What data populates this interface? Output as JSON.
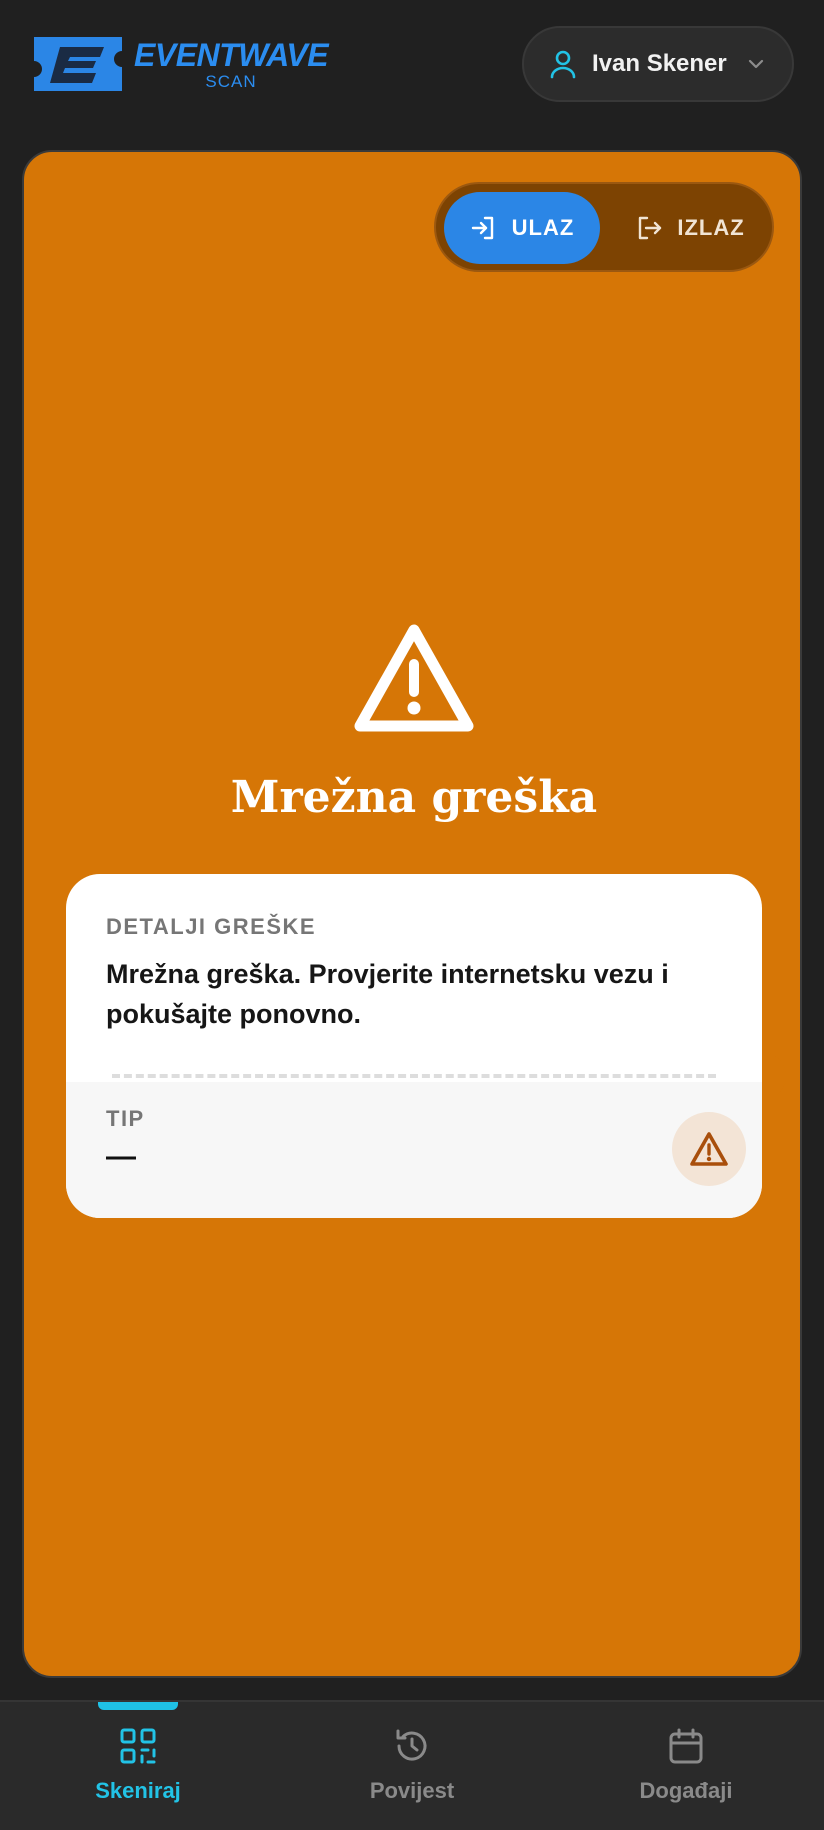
{
  "brand": {
    "name": "EVENTWAVE",
    "subtitle": "SCAN",
    "color": "#2b8df0"
  },
  "user": {
    "name": "Ivan Skener",
    "icon": "user-icon",
    "accent": "#22c3e6"
  },
  "mode_toggle": {
    "selected": "ULAZ",
    "options": [
      {
        "label": "ULAZ",
        "icon": "enter-icon"
      },
      {
        "label": "IZLAZ",
        "icon": "exit-icon"
      }
    ]
  },
  "status": {
    "icon": "warning-icon",
    "title": "Mrežna greška",
    "background": "#d67606"
  },
  "ticket": {
    "details_label": "DETALJI GREŠKE",
    "message": "Mrežna greška. Provjerite internetsku vezu i pokušajte ponovno.",
    "tip_label": "TIP",
    "tip_value": "—",
    "tip_icon": "warning-icon"
  },
  "bottom_nav": {
    "active": "Skeniraj",
    "items": [
      {
        "label": "Skeniraj",
        "icon": "qr-code-icon"
      },
      {
        "label": "Povijest",
        "icon": "history-icon"
      },
      {
        "label": "Događaji",
        "icon": "calendar-icon"
      }
    ]
  }
}
